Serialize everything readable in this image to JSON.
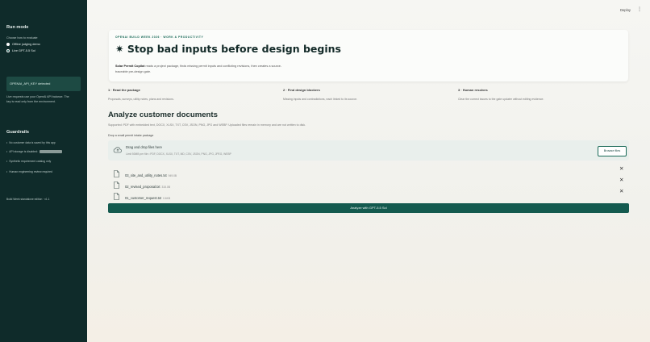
{
  "sidebar": {
    "run_mode_title": "Run mode",
    "choose_label": "Choose how to evaluate",
    "options": [
      "Offline judging demo",
      "Live GPT-5.5 Sol"
    ],
    "key_status": "OPENAI_API_KEY detected",
    "key_note_1": "Live requests use your OpenAI API balance. The",
    "key_note_2": "key is read only from the environment.",
    "guardrails_title": "Guardrails",
    "guardrails": [
      "No customer data is saved by this app",
      "API storage is disabled:",
      "Synthetic requirement catalog only",
      "Human engineering review required"
    ],
    "footer": "Build Week standalone edition · v1.1"
  },
  "topbar": {
    "deploy": "Deploy",
    "menu": "⋮"
  },
  "hero": {
    "kicker": "OPENAI BUILD WEEK 2026 · WORK & PRODUCTIVITY",
    "title": "✷ Stop bad inputs before design begins",
    "brand": "Solar Permit Copilot",
    "desc_rest": " reads a project package, finds missing permit inputs and conflicting revisions, then creates a source-",
    "desc_line2": "traceable pre-design gate."
  },
  "steps": [
    {
      "title": "1 · Read the package",
      "desc": "Proposals, surveys, utility notes, plans and revisions."
    },
    {
      "title": "2 · Find design blockers",
      "desc": "Missing inputs and contradictions, each linked to its source."
    },
    {
      "title": "3 · Human resolves",
      "desc": "Clear the correct issues to the gate updater without editing evidence."
    }
  ],
  "section": {
    "title": "Analyze customer documents",
    "supported": "Supported: PDF with embedded text, DOCX, XLSX, TXT, CSV, JSON, PNG, JPG and WEBP. Uploaded files remain in memory and are not written to disk.",
    "drop_label": "Drop a small permit intake package"
  },
  "dropzone": {
    "title": "Drag and drop files here",
    "limit": "Limit 50MB per file • PDF, DOCX, XLSX, TXT, MD, CSV, JSON, PNG, JPG, JPEG, WEBP",
    "browse": "Browse files"
  },
  "files": [
    {
      "name": "03_site_and_utility_notes.txt",
      "size": "949.0B"
    },
    {
      "name": "02_revised_proposal.txt",
      "size": "315.0B"
    },
    {
      "name": "01_customer_request.txt",
      "size": "0.6KB"
    }
  ],
  "analyze_button": "Analyze with GPT-5.5 Sol",
  "colors": {
    "sidebar": "#0f2b2a",
    "accent": "#145a4f",
    "hero_kicker": "#1a6a58"
  }
}
